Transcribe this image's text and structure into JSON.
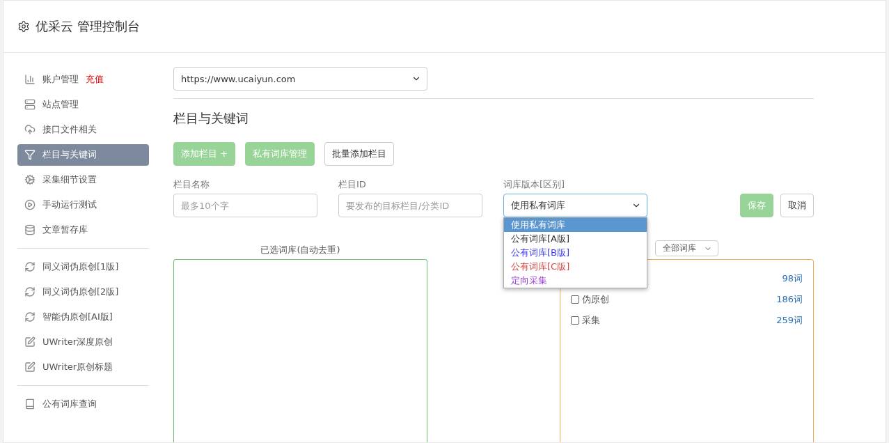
{
  "header": {
    "title": "优采云 管理控制台"
  },
  "sidebar": {
    "groups": [
      {
        "items": [
          {
            "label": "账户管理",
            "badge": "充值",
            "selected": false
          },
          {
            "label": "站点管理",
            "selected": false
          },
          {
            "label": "接口文件相关",
            "selected": false
          },
          {
            "label": "栏目与关键词",
            "selected": true
          },
          {
            "label": "采集细节设置",
            "selected": false
          },
          {
            "label": "手动运行测试",
            "selected": false
          },
          {
            "label": "文章暂存库",
            "selected": false
          }
        ]
      },
      {
        "items": [
          {
            "label": "同义词伪原创[1版]",
            "selected": false
          },
          {
            "label": "同义词伪原创[2版]",
            "selected": false
          },
          {
            "label": "智能伪原创[AI版]",
            "selected": false
          },
          {
            "label": "UWriter深度原创",
            "selected": false
          },
          {
            "label": "UWriter原创标题",
            "selected": false
          }
        ]
      },
      {
        "items": [
          {
            "label": "公有词库查询",
            "selected": false
          }
        ]
      }
    ]
  },
  "site_select": {
    "value": "https://www.ucaiyun.com"
  },
  "section_title": "栏目与关键词",
  "toolbar": [
    {
      "label": "添加栏目 +",
      "kind": "primary"
    },
    {
      "label": "私有词库管理",
      "kind": "primary"
    },
    {
      "label": "批量添加栏目",
      "kind": "default"
    }
  ],
  "form": {
    "fields": [
      {
        "label": "栏目名称",
        "placeholder": "最多10个字"
      },
      {
        "label": "栏目ID",
        "placeholder": "要发布的目标栏目/分类ID"
      }
    ],
    "version_select": {
      "label": "词库版本[区别]",
      "value": "使用私有词库",
      "expanded": true,
      "options": [
        {
          "label": "使用私有词库",
          "selected": true
        },
        {
          "label": "公有词库[A版]",
          "color": "#333333",
          "selected": false
        },
        {
          "label": "公有词库[B版]",
          "color": "#3b3bf0",
          "selected": false
        },
        {
          "label": "公有词库[C版]",
          "color": "#d64545",
          "selected": false
        },
        {
          "label": "定向采集",
          "color": "#9b3fd6",
          "selected": false
        }
      ]
    },
    "actions": [
      {
        "label": "保存",
        "kind": "primary"
      },
      {
        "label": "取消",
        "kind": "default"
      }
    ]
  },
  "selected_panel": {
    "title": "已选词库(自动去重)"
  },
  "library_panel": {
    "filter": "全部词库",
    "rows": [
      {
        "count": "98词"
      },
      {
        "label": "伪原创",
        "count": "186词",
        "checked": false
      },
      {
        "label": "采集",
        "count": "259词",
        "checked": false
      }
    ]
  }
}
